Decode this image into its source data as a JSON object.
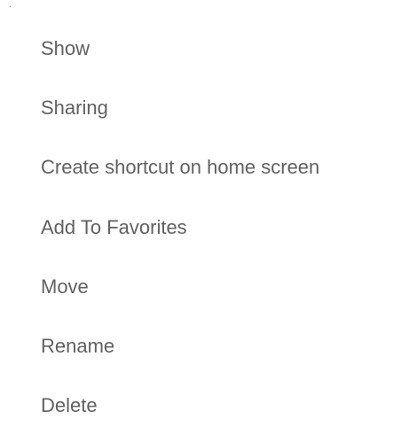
{
  "menu": {
    "items": [
      {
        "label": "Show"
      },
      {
        "label": "Sharing"
      },
      {
        "label": "Create shortcut on home screen"
      },
      {
        "label": "Add To Favorites"
      },
      {
        "label": "Move"
      },
      {
        "label": "Rename"
      },
      {
        "label": "Delete"
      }
    ]
  }
}
